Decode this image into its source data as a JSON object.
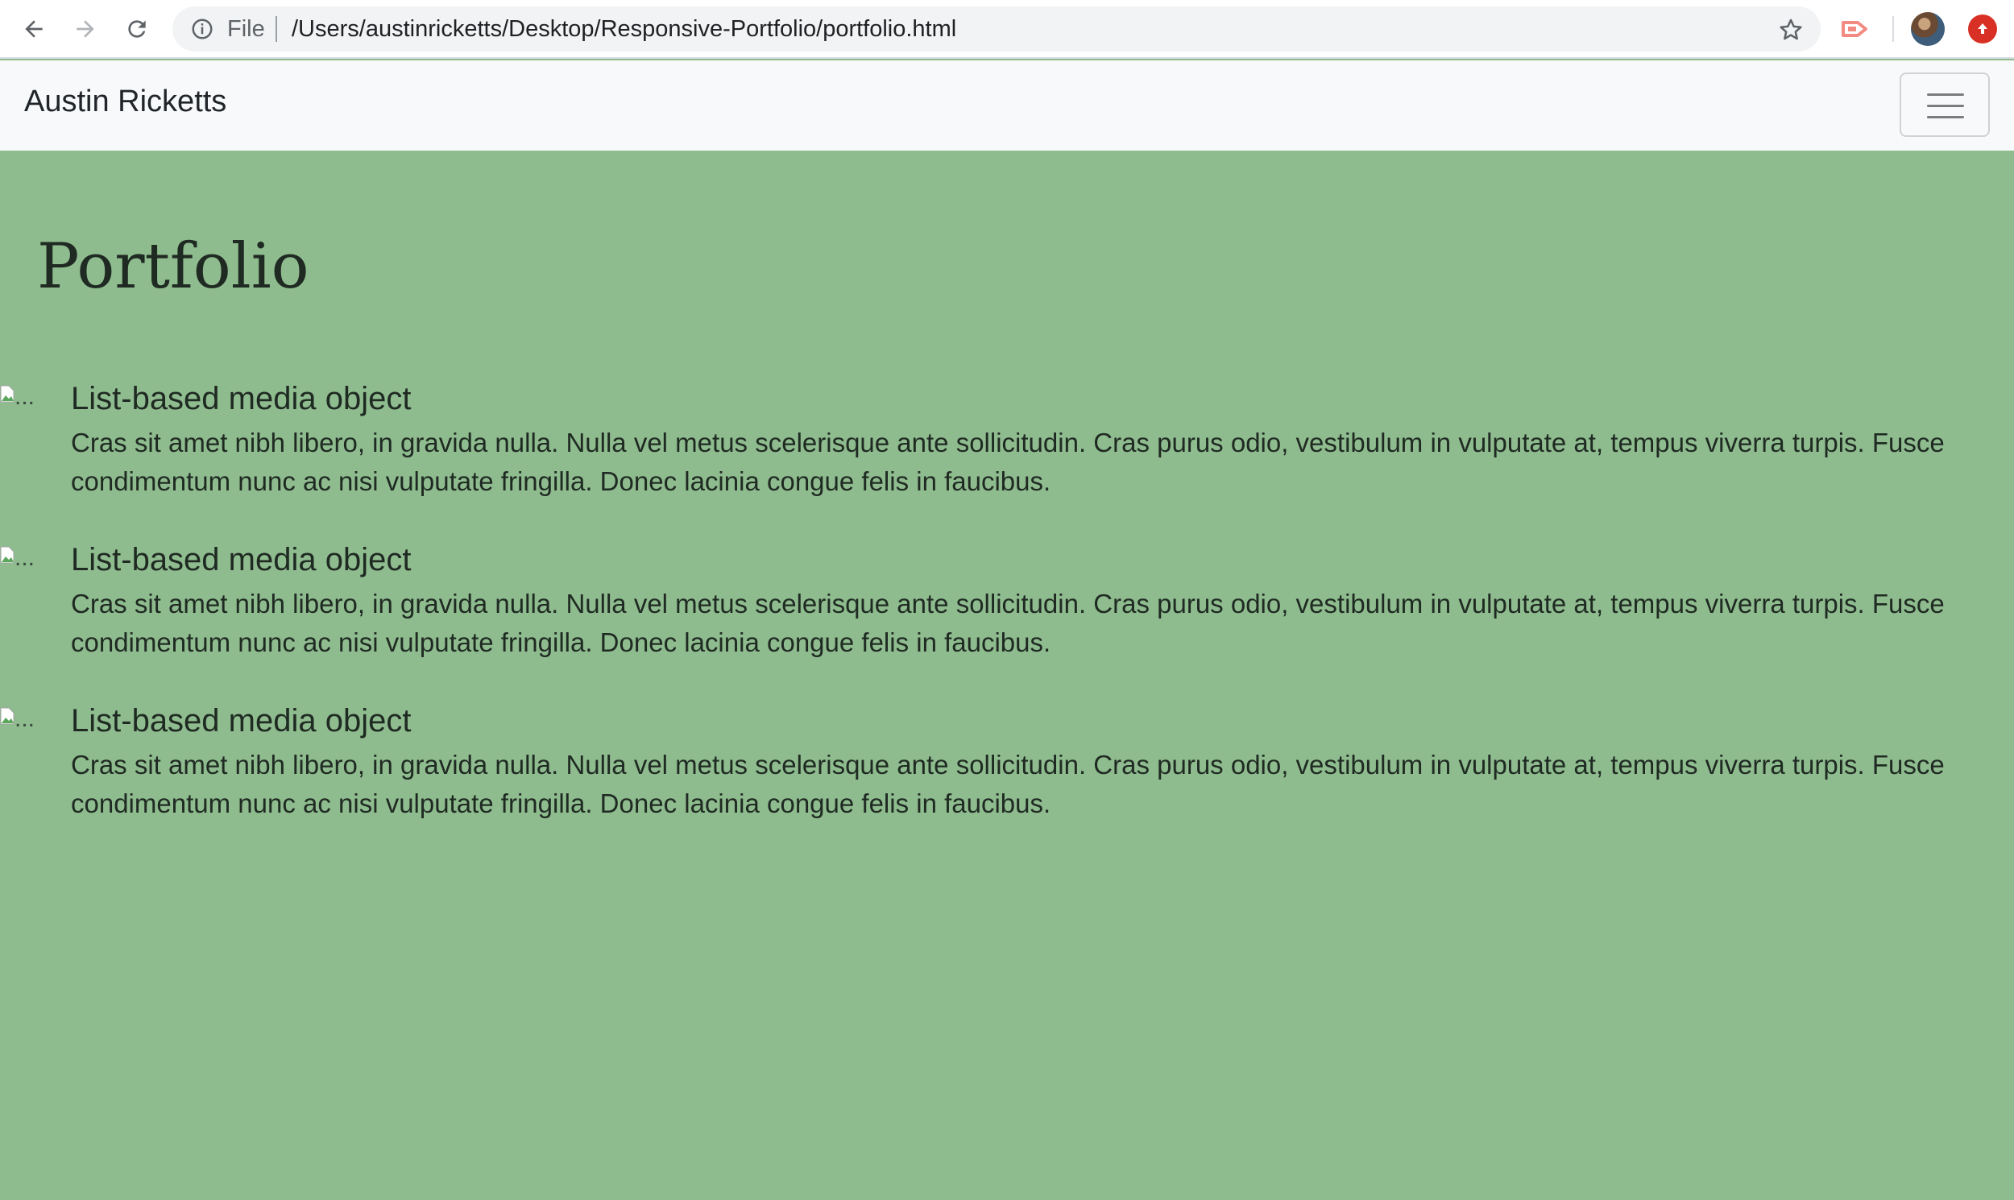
{
  "browser": {
    "scheme_label": "File",
    "url": "/Users/austinricketts/Desktop/Responsive-Portfolio/portfolio.html"
  },
  "navbar": {
    "brand": "Austin Ricketts"
  },
  "main": {
    "title": "Portfolio",
    "media_items": [
      {
        "img_alt": "...",
        "heading": "List-based media object",
        "text": "Cras sit amet nibh libero, in gravida nulla. Nulla vel metus scelerisque ante sollicitudin. Cras purus odio, vestibulum in vulputate at, tempus viverra turpis. Fusce condimentum nunc ac nisi vulputate fringilla. Donec lacinia congue felis in faucibus."
      },
      {
        "img_alt": "...",
        "heading": "List-based media object",
        "text": "Cras sit amet nibh libero, in gravida nulla. Nulla vel metus scelerisque ante sollicitudin. Cras purus odio, vestibulum in vulputate at, tempus viverra turpis. Fusce condimentum nunc ac nisi vulputate fringilla. Donec lacinia congue felis in faucibus."
      },
      {
        "img_alt": "...",
        "heading": "List-based media object",
        "text": "Cras sit amet nibh libero, in gravida nulla. Nulla vel metus scelerisque ante sollicitudin. Cras purus odio, vestibulum in vulputate at, tempus viverra turpis. Fusce condimentum nunc ac nisi vulputate fringilla. Donec lacinia congue felis in faucibus."
      }
    ]
  },
  "colors": {
    "page_background": "#8fbc8f",
    "navbar_background": "#f8f9fa",
    "text": "#1f2a22"
  }
}
